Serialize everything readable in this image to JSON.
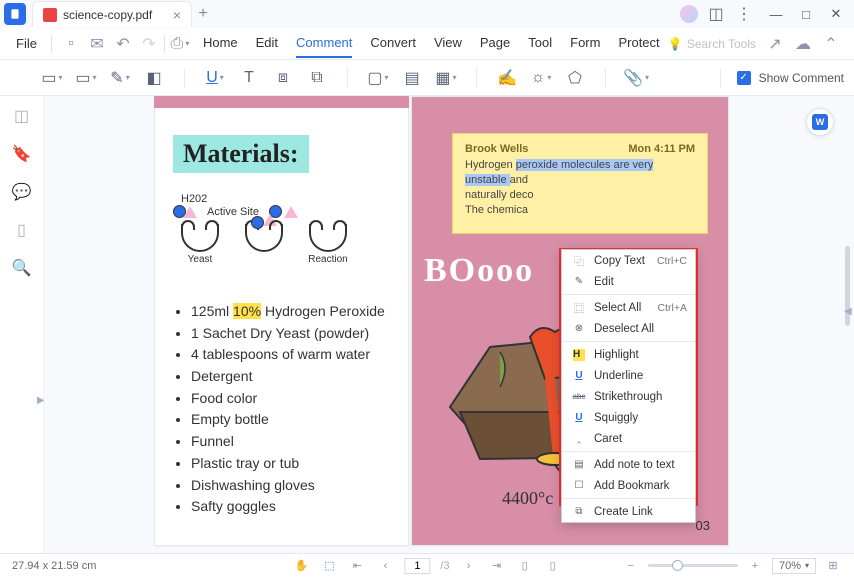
{
  "app": {
    "tab_name": "science-copy.pdf"
  },
  "menubar": {
    "file": "File",
    "tabs": [
      "Home",
      "Edit",
      "Comment",
      "Convert",
      "View",
      "Page",
      "Tool",
      "Form",
      "Protect"
    ],
    "active_index": 2,
    "search_placeholder": "Search Tools"
  },
  "toolbar": {
    "show_comment": "Show Comment"
  },
  "document": {
    "materials_heading": "Materials:",
    "diagram": {
      "h2o2": "H202",
      "active_site": "Active Site",
      "yeast": "Yeast",
      "reaction": "Reaction"
    },
    "list_items": [
      {
        "prefix": "125ml ",
        "highlight": "10%",
        "suffix": " Hydrogen Peroxide"
      },
      {
        "text": "1 Sachet Dry Yeast (powder)"
      },
      {
        "text": "4 tablespoons of warm water"
      },
      {
        "text": "Detergent"
      },
      {
        "text": "Food color"
      },
      {
        "text": "Empty bottle"
      },
      {
        "text": "Funnel"
      },
      {
        "text": "Plastic tray or tub"
      },
      {
        "text": "Dishwashing gloves"
      },
      {
        "text": "Safty goggles"
      }
    ],
    "note": {
      "author": "Brook Wells",
      "timestamp": "Mon 4:11 PM",
      "line1a": "Hydrogen ",
      "line1b": "peroxide molecules are very unstable ",
      "line1c": "and",
      "line2": "naturally deco",
      "line3": "The chemica"
    },
    "booom": "BOooo",
    "temperature": "4400°c",
    "page_number": "03"
  },
  "context_menu": {
    "items": [
      {
        "icon": "copy",
        "label": "Copy Text",
        "shortcut": "Ctrl+C"
      },
      {
        "icon": "edit",
        "label": "Edit",
        "shortcut": ""
      },
      {
        "sep": true
      },
      {
        "icon": "select-all",
        "label": "Select All",
        "shortcut": "Ctrl+A"
      },
      {
        "icon": "deselect",
        "label": "Deselect All",
        "shortcut": ""
      },
      {
        "sep": true
      },
      {
        "icon": "highlight",
        "label": "Highlight",
        "shortcut": ""
      },
      {
        "icon": "underline",
        "label": "Underline",
        "shortcut": ""
      },
      {
        "icon": "strike",
        "label": "Strikethrough",
        "shortcut": ""
      },
      {
        "icon": "squiggly",
        "label": "Squiggly",
        "shortcut": ""
      },
      {
        "icon": "caret",
        "label": "Caret",
        "shortcut": ""
      },
      {
        "sep": true
      },
      {
        "icon": "note",
        "label": "Add note to text",
        "shortcut": ""
      },
      {
        "icon": "bookmark",
        "label": "Add Bookmark",
        "shortcut": ""
      },
      {
        "sep": true
      },
      {
        "icon": "link",
        "label": "Create Link",
        "shortcut": ""
      }
    ]
  },
  "statusbar": {
    "dimensions": "27.94 x 21.59 cm",
    "page_current": "1",
    "page_total": "/3",
    "zoom": "70%"
  }
}
